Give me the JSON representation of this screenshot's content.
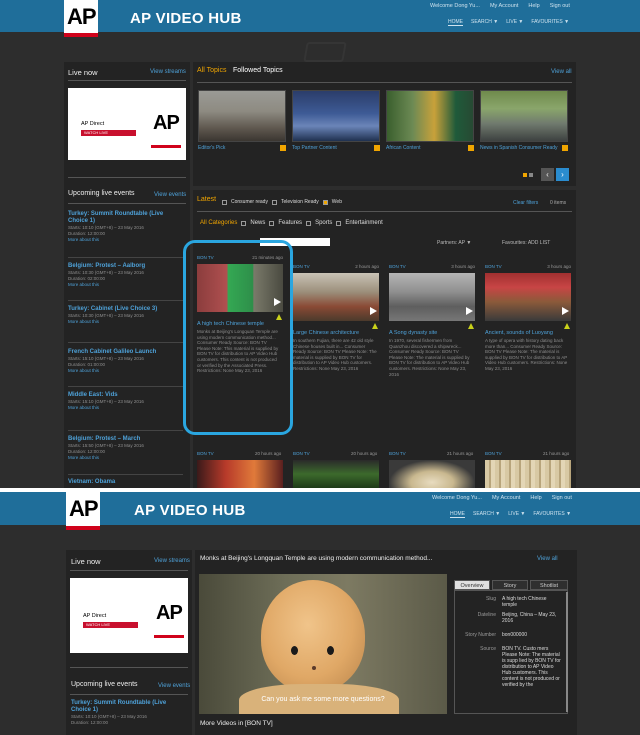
{
  "header": {
    "brand": "AP VIDEO HUB",
    "logo_text": "AP",
    "welcome": "Welcome Dong Yu...",
    "my_account": "My Account",
    "help": "Help",
    "sign_out": "Sign out",
    "nav": [
      "HOME",
      "SEARCH ▼",
      "LIVE ▼",
      "FAVOURITES ▼"
    ]
  },
  "left": {
    "live_now": "Live now",
    "view_streams": "View streams",
    "ap_direct": "AP Direct",
    "watch_live": "WATCH LIVE",
    "upcoming": "Upcoming live events",
    "view_events": "View events",
    "events": [
      {
        "title": "Turkey: Summit Roundtable (Live Choice 1)",
        "start": "Starts: 10:10 (GMT+8) – 23 May 2016",
        "duration": "Duration: 12:00:00",
        "link": "More about this"
      },
      {
        "title": "Belgium: Protest – Aalborg",
        "start": "Starts: 10:30 (GMT+8) – 23 May 2016",
        "duration": "Duration: 02:00:00",
        "link": "More about this"
      },
      {
        "title": "Turkey: Cabinet (Live Choice 3)",
        "start": "Starts: 10:30 (GMT+8) – 23 May 2016",
        "duration": "",
        "link": "More about this"
      },
      {
        "title": "French Cabinet Galileo Launch",
        "start": "Starts: 15:10 (GMT+8) – 23 May 2016",
        "duration": "Duration: 01:00:00",
        "link": "More about this"
      },
      {
        "title": "Middle East: Vids",
        "start": "Starts: 15:10 (GMT+8) – 23 May 2016",
        "duration": "",
        "link": "More about this"
      },
      {
        "title": "Belgium: Protest – March",
        "start": "Starts: 15:50 (GMT+8) – 23 May 2016",
        "duration": "Duration: 12:00:00",
        "link": "More about this"
      },
      {
        "title": "Vietnam: Obama",
        "start": "",
        "duration": "",
        "link": ""
      }
    ]
  },
  "topics": {
    "all": "All Topics",
    "followed": "Followed Topics",
    "view_all": "View all",
    "items": [
      "Editor's Pick",
      "Top Partner Content",
      "African Content",
      "News in Spanish Consumer Ready"
    ]
  },
  "latest": {
    "label": "Latest",
    "consumer_ready": "Consumer ready",
    "television": "Television Ready",
    "web": "Web",
    "clear_filters": "Clear filters",
    "items_count": "0 items",
    "categories": [
      "All Categories",
      "News",
      "Features",
      "Sports",
      "Entertainment"
    ],
    "partners": "Partners: AP ▼",
    "favourites": "Favourites: ADD LIST"
  },
  "cards": [
    {
      "source": "BON TV",
      "age": "21 minutes ago",
      "title": "A high tech Chinese temple",
      "desc": "Monks at Beijing's Longquan Temple are using modern communication method... Consumer Ready Source: BON TV Please Note: This material is supplied by BON TV for distribution to AP Video Hub customers. This content is not produced or verified by the Associated Press. Restrictions: None May 23, 2016"
    },
    {
      "source": "BON TV",
      "age": "2 hours ago",
      "title": "Large Chinese architecture",
      "desc": "In southern Fujian, there are 42 old style Chinese houses built in... Consumer Ready Source: BON TV Please Note: The material is supplied by BON TV for distribution to AP Video Hub customers. Restrictions: None May 23, 2016"
    },
    {
      "source": "BON TV",
      "age": "3 hours ago",
      "title": "A Song dynasty site",
      "desc": "In 1970, several fishermen from Quanzhou discovered a shipwreck... Consumer Ready Source: BON TV Please Note: The material is supplied by BON TV for distribution to AP Video Hub customers. Restrictions: None May 23, 2016"
    },
    {
      "source": "BON TV",
      "age": "3 hours ago",
      "title": "Ancient, sounds of Luoyang",
      "desc": "A type of opera with history dating back more than... Consumer Ready Source: BON TV Please Note: The material is supplied by BON TV for distribution to AP Video Hub customers. Restrictions: None May 23, 2016"
    }
  ],
  "bottom_row": [
    {
      "source": "BON TV",
      "age": "20 hours ago"
    },
    {
      "source": "BON TV",
      "age": "20 hours ago"
    },
    {
      "source": "BON TV",
      "age": "21 hours ago"
    },
    {
      "source": "BON TV",
      "age": "21 hours ago"
    }
  ],
  "detail": {
    "title": "Monks at Beijing's Longquan Temple are using modern communication method...",
    "view_all": "View all",
    "tabs": [
      "Overview",
      "Story",
      "Shotlist"
    ],
    "subtitle": "Can you ask me some more questions?",
    "more_videos": "More Videos in [BON TV]",
    "fields": [
      {
        "label": "Slug",
        "value": "A high tech Chinese temple"
      },
      {
        "label": "Dateline",
        "value": "Beijing, China – May 23, 2016"
      },
      {
        "label": "Story Number",
        "value": "bon000000"
      },
      {
        "label": "Source",
        "value": "BON TV. Custo mers Please Note: The material is supp lied by BON TV for distribution to AP Video Hub customers. This content is not produced or verified by the"
      }
    ]
  },
  "colors": {
    "header": "#1f6e9a",
    "accent": "#f0a500",
    "link": "#4ea1d8",
    "highlight": "#2aa6e0",
    "ap_red": "#d0021b"
  }
}
